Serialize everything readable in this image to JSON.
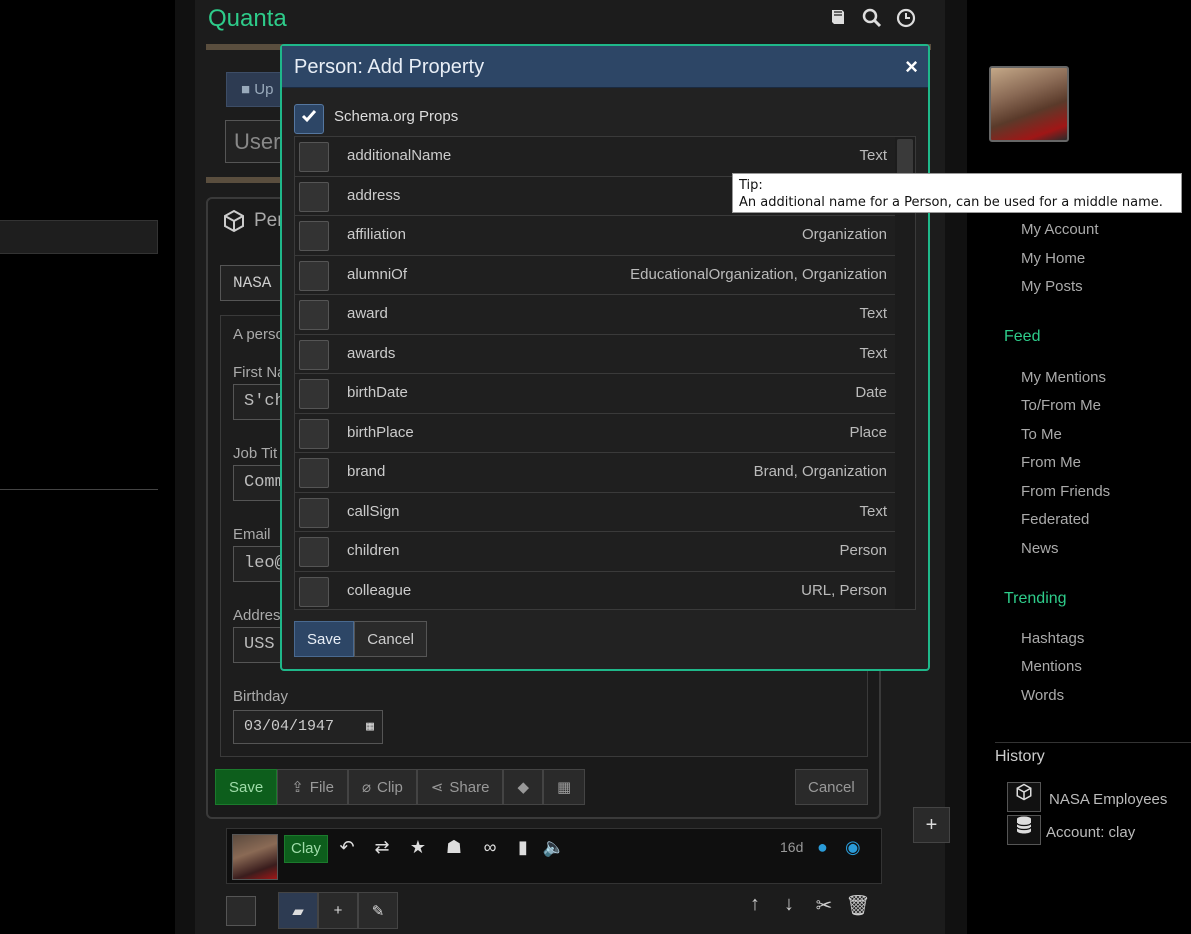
{
  "app": {
    "title": "Quanta"
  },
  "header_icons": [
    "book-icon",
    "search-icon",
    "clock-icon"
  ],
  "center": {
    "crumb_label": "Up",
    "user_input_text": "User",
    "editor": {
      "title": "Per",
      "nasa_text": "NASA",
      "description": "A perso",
      "fields": [
        {
          "label": "First Na",
          "value": "S'ch"
        },
        {
          "label": "Job Tit",
          "value": "Comm"
        },
        {
          "label": "Email",
          "value": "leo@"
        },
        {
          "label": "Addres",
          "value": "USS"
        }
      ],
      "birthday_label": "Birthday",
      "birthday_value": "03/04/1947",
      "buttons": {
        "save": "Save",
        "file": "File",
        "clip": "Clip",
        "share": "Share",
        "cancel": "Cancel"
      }
    },
    "post": {
      "author": "Clay",
      "age": "16d"
    }
  },
  "dialog": {
    "title": "Person: Add Property",
    "close": "×",
    "schema_checkbox_label": "Schema.org Props",
    "schema_checked": true,
    "properties": [
      {
        "name": "additionalName",
        "type": "Text"
      },
      {
        "name": "address",
        "type": ""
      },
      {
        "name": "affiliation",
        "type": "Organization"
      },
      {
        "name": "alumniOf",
        "type": "EducationalOrganization, Organization"
      },
      {
        "name": "award",
        "type": "Text"
      },
      {
        "name": "awards",
        "type": "Text"
      },
      {
        "name": "birthDate",
        "type": "Date"
      },
      {
        "name": "birthPlace",
        "type": "Place"
      },
      {
        "name": "brand",
        "type": "Brand, Organization"
      },
      {
        "name": "callSign",
        "type": "Text"
      },
      {
        "name": "children",
        "type": "Person"
      },
      {
        "name": "colleague",
        "type": "URL, Person"
      }
    ],
    "save_label": "Save",
    "cancel_label": "Cancel"
  },
  "tooltip": {
    "title": "Tip:",
    "text": "An additional name for a Person, can be used for a middle name."
  },
  "sidebar": {
    "account_items": [
      "My Account",
      "My Home",
      "My Posts"
    ],
    "feed_heading": "Feed",
    "feed_items": [
      "My Mentions",
      "To/From Me",
      "To Me",
      "From Me",
      "From Friends",
      "Federated",
      "News"
    ],
    "trending_heading": "Trending",
    "trending_items": [
      "Hashtags",
      "Mentions",
      "Words"
    ],
    "history_heading": "History",
    "history_items": [
      {
        "icon": "cube-icon",
        "label": "NASA Employees"
      },
      {
        "icon": "database-icon",
        "label": "Account: clay"
      }
    ]
  },
  "colors": {
    "accent_green": "#2ecc8a",
    "dialog_border": "#1fb88a",
    "dialog_header": "#2d4666",
    "save_green": "#0d5e1c",
    "link_blue": "#2a9bd8"
  }
}
